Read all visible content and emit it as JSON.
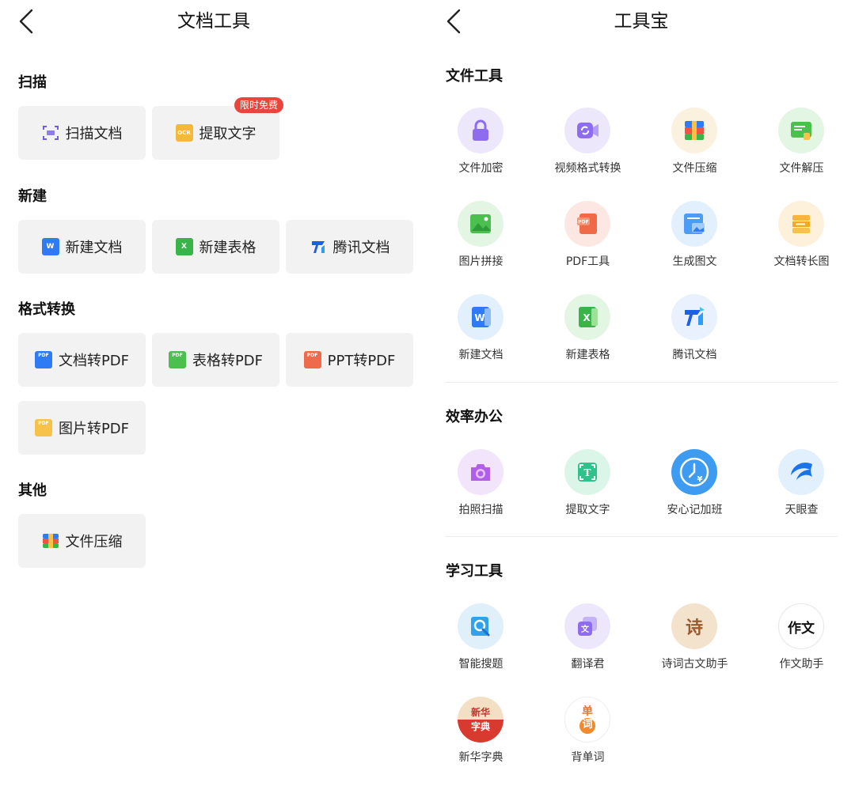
{
  "left": {
    "title": "文档工具",
    "sections": [
      {
        "title": "扫描",
        "items": [
          {
            "label": "扫描文档",
            "icon": "scan-icon"
          },
          {
            "label": "提取文字",
            "icon": "ocr-icon",
            "badge": "限时免费"
          }
        ]
      },
      {
        "title": "新建",
        "items": [
          {
            "label": "新建文档",
            "icon": "word-doc-icon"
          },
          {
            "label": "新建表格",
            "icon": "excel-sheet-icon"
          },
          {
            "label": "腾讯文档",
            "icon": "tencent-docs-icon"
          }
        ]
      },
      {
        "title": "格式转换",
        "items": [
          {
            "label": "文档转PDF",
            "icon": "doc-to-pdf-icon"
          },
          {
            "label": "表格转PDF",
            "icon": "sheet-to-pdf-icon"
          },
          {
            "label": "PPT转PDF",
            "icon": "ppt-to-pdf-icon"
          },
          {
            "label": "图片转PDF",
            "icon": "image-to-pdf-icon"
          }
        ]
      },
      {
        "title": "其他",
        "items": [
          {
            "label": "文件压缩",
            "icon": "compress-icon"
          }
        ]
      }
    ]
  },
  "right": {
    "title": "工具宝",
    "sections": [
      {
        "title": "文件工具",
        "items": [
          {
            "label": "文件加密",
            "icon": "lock-icon"
          },
          {
            "label": "视频格式转换",
            "icon": "video-convert-icon"
          },
          {
            "label": "文件压缩",
            "icon": "zip-icon"
          },
          {
            "label": "文件解压",
            "icon": "unzip-icon"
          },
          {
            "label": "图片拼接",
            "icon": "image-stitch-icon"
          },
          {
            "label": "PDF工具",
            "icon": "pdf-tool-icon"
          },
          {
            "label": "生成图文",
            "icon": "image-text-icon"
          },
          {
            "label": "文档转长图",
            "icon": "doc-long-image-icon"
          },
          {
            "label": "新建文档",
            "icon": "word-icon"
          },
          {
            "label": "新建表格",
            "icon": "excel-icon"
          },
          {
            "label": "腾讯文档",
            "icon": "tencent-docs-icon"
          }
        ]
      },
      {
        "title": "效率办公",
        "items": [
          {
            "label": "拍照扫描",
            "icon": "camera-icon"
          },
          {
            "label": "提取文字",
            "icon": "text-extract-icon"
          },
          {
            "label": "安心记加班",
            "icon": "overtime-clock-icon"
          },
          {
            "label": "天眼查",
            "icon": "tianyancha-icon"
          }
        ]
      },
      {
        "title": "学习工具",
        "items": [
          {
            "label": "智能搜题",
            "icon": "search-question-icon"
          },
          {
            "label": "翻译君",
            "icon": "translate-icon"
          },
          {
            "label": "诗词古文助手",
            "icon": "poetry-icon",
            "glyph": "诗"
          },
          {
            "label": "作文助手",
            "icon": "essay-icon",
            "glyph": "作文"
          },
          {
            "label": "新华字典",
            "icon": "dictionary-icon",
            "glyph_top": "新华",
            "glyph_bottom": "字典"
          },
          {
            "label": "背单词",
            "icon": "vocabulary-icon",
            "glyph_top": "单",
            "glyph_bottom": "词"
          }
        ]
      }
    ]
  },
  "colors": {
    "badge": "#e8453c",
    "card_bg": "#f2f2f2",
    "word_blue": "#2f7bf5",
    "excel_green": "#38b449"
  }
}
